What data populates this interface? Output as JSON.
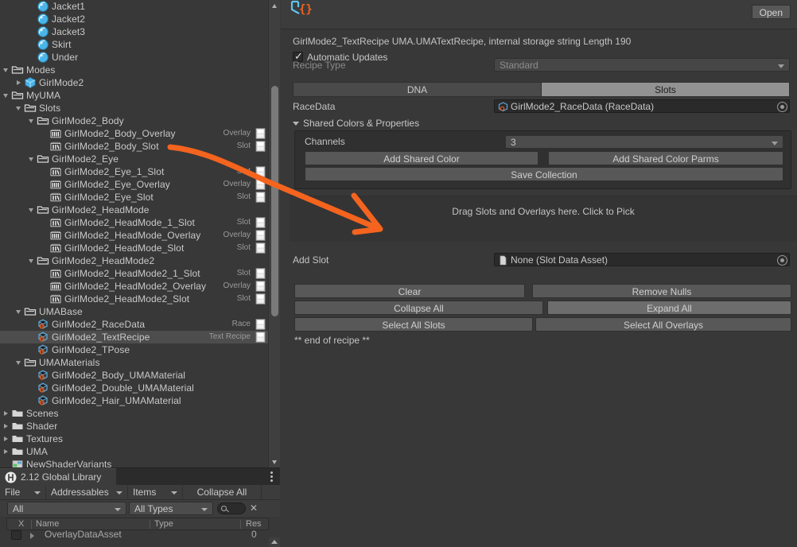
{
  "project_panel": {
    "rows": [
      {
        "indent": 3,
        "tw": "none",
        "icon": "sphere-icon",
        "label": "Jacket1",
        "type": "",
        "badge": false
      },
      {
        "indent": 3,
        "tw": "none",
        "icon": "sphere-icon",
        "label": "Jacket2",
        "type": "",
        "badge": false
      },
      {
        "indent": 3,
        "tw": "none",
        "icon": "sphere-icon",
        "label": "Jacket3",
        "type": "",
        "badge": false
      },
      {
        "indent": 3,
        "tw": "none",
        "icon": "sphere-icon",
        "label": "Skirt",
        "type": "",
        "badge": false
      },
      {
        "indent": 3,
        "tw": "none",
        "icon": "sphere-icon",
        "label": "Under",
        "type": "",
        "badge": false
      },
      {
        "indent": 1,
        "tw": "open",
        "icon": "folder-icon",
        "label": "Modes",
        "type": "",
        "badge": false
      },
      {
        "indent": 2,
        "tw": "closed",
        "icon": "prefab-icon",
        "label": "GirlMode2",
        "type": "",
        "badge": false
      },
      {
        "indent": 1,
        "tw": "open",
        "icon": "folder-icon",
        "label": "MyUMA",
        "type": "",
        "badge": false
      },
      {
        "indent": 2,
        "tw": "open",
        "icon": "folder-icon",
        "label": "Slots",
        "type": "",
        "badge": false
      },
      {
        "indent": 3,
        "tw": "open",
        "icon": "folder-icon",
        "label": "GirlMode2_Body",
        "type": "",
        "badge": false
      },
      {
        "indent": 4,
        "tw": "none",
        "icon": "overlay-icon",
        "label": "GirlMode2_Body_Overlay",
        "type": "Overlay",
        "badge": true
      },
      {
        "indent": 4,
        "tw": "none",
        "icon": "slot-icon",
        "label": "GirlMode2_Body_Slot",
        "type": "Slot",
        "badge": true
      },
      {
        "indent": 3,
        "tw": "open",
        "icon": "folder-icon",
        "label": "GirlMode2_Eye",
        "type": "",
        "badge": false
      },
      {
        "indent": 4,
        "tw": "none",
        "icon": "slot-icon",
        "label": "GirlMode2_Eye_1_Slot",
        "type": "Slot",
        "badge": true
      },
      {
        "indent": 4,
        "tw": "none",
        "icon": "overlay-icon",
        "label": "GirlMode2_Eye_Overlay",
        "type": "Overlay",
        "badge": true
      },
      {
        "indent": 4,
        "tw": "none",
        "icon": "slot-icon",
        "label": "GirlMode2_Eye_Slot",
        "type": "Slot",
        "badge": true
      },
      {
        "indent": 3,
        "tw": "open",
        "icon": "folder-icon",
        "label": "GirlMode2_HeadMode",
        "type": "",
        "badge": false
      },
      {
        "indent": 4,
        "tw": "none",
        "icon": "slot-icon",
        "label": "GirlMode2_HeadMode_1_Slot",
        "type": "Slot",
        "badge": true
      },
      {
        "indent": 4,
        "tw": "none",
        "icon": "overlay-icon",
        "label": "GirlMode2_HeadMode_Overlay",
        "type": "Overlay",
        "badge": true
      },
      {
        "indent": 4,
        "tw": "none",
        "icon": "slot-icon",
        "label": "GirlMode2_HeadMode_Slot",
        "type": "Slot",
        "badge": true
      },
      {
        "indent": 3,
        "tw": "open",
        "icon": "folder-icon",
        "label": "GirlMode2_HeadMode2",
        "type": "",
        "badge": false
      },
      {
        "indent": 4,
        "tw": "none",
        "icon": "slot-icon",
        "label": "GirlMode2_HeadMode2_1_Slot",
        "type": "Slot",
        "badge": true
      },
      {
        "indent": 4,
        "tw": "none",
        "icon": "overlay-icon",
        "label": "GirlMode2_HeadMode2_Overlay",
        "type": "Overlay",
        "badge": true
      },
      {
        "indent": 4,
        "tw": "none",
        "icon": "slot-icon",
        "label": "GirlMode2_HeadMode2_Slot",
        "type": "Slot",
        "badge": true
      },
      {
        "indent": 2,
        "tw": "open",
        "icon": "folder-icon",
        "label": "UMABase",
        "type": "",
        "badge": false
      },
      {
        "indent": 3,
        "tw": "none",
        "icon": "uma-icon",
        "label": "GirlMode2_RaceData",
        "type": "Race",
        "badge": true
      },
      {
        "indent": 3,
        "tw": "none",
        "icon": "uma-icon",
        "label": "GirlMode2_TextRecipe",
        "type": "Text Recipe",
        "badge": true,
        "selected": true
      },
      {
        "indent": 3,
        "tw": "none",
        "icon": "uma-icon",
        "label": "GirlMode2_TPose",
        "type": "",
        "badge": false
      },
      {
        "indent": 2,
        "tw": "open",
        "icon": "folder-icon",
        "label": "UMAMaterials",
        "type": "",
        "badge": false
      },
      {
        "indent": 3,
        "tw": "none",
        "icon": "uma-icon",
        "label": "GirlMode2_Body_UMAMaterial",
        "type": "",
        "badge": false
      },
      {
        "indent": 3,
        "tw": "none",
        "icon": "uma-icon",
        "label": "GirlMode2_Double_UMAMaterial",
        "type": "",
        "badge": false
      },
      {
        "indent": 3,
        "tw": "none",
        "icon": "uma-icon",
        "label": "GirlMode2_Hair_UMAMaterial",
        "type": "",
        "badge": false
      },
      {
        "indent": 1,
        "tw": "closed",
        "icon": "folder-solid-icon",
        "label": "Scenes",
        "type": "",
        "badge": false
      },
      {
        "indent": 1,
        "tw": "closed",
        "icon": "folder-solid-icon",
        "label": "Shader",
        "type": "",
        "badge": false
      },
      {
        "indent": 1,
        "tw": "closed",
        "icon": "folder-solid-icon",
        "label": "Textures",
        "type": "",
        "badge": false
      },
      {
        "indent": 1,
        "tw": "closed",
        "icon": "folder-solid-icon",
        "label": "UMA",
        "type": "",
        "badge": false
      },
      {
        "indent": 1,
        "tw": "none",
        "icon": "shadervariant-icon",
        "label": "NewShaderVariants",
        "type": "",
        "badge": false
      }
    ]
  },
  "inspector": {
    "open_button": "Open",
    "summary": "GirlMode2_TextRecipe UMA.UMATextRecipe, internal storage string Length 190",
    "automatic_updates_label": "Automatic Updates",
    "recipe_type_label": "Recipe Type",
    "recipe_type_value": "Standard",
    "tab_dna": "DNA",
    "tab_slots": "Slots",
    "racedata_label": "RaceData",
    "racedata_value": "GirlMode2_RaceData (RaceData)",
    "shared_colors_foldout": "Shared Colors & Properties",
    "channels_label": "Channels",
    "channels_value": "3",
    "add_shared_color": "Add Shared Color",
    "add_shared_color_parms": "Add Shared Color Parms",
    "save_collection": "Save Collection",
    "drop_area_text": "Drag Slots and Overlays here. Click to Pick",
    "add_slot_label": "Add Slot",
    "add_slot_value": "None (Slot Data Asset)",
    "btn_clear": "Clear",
    "btn_remove_nulls": "Remove Nulls",
    "btn_collapse_all": "Collapse All",
    "btn_expand_all": "Expand All",
    "btn_select_all_slots": "Select All Slots",
    "btn_select_all_overlays": "Select All Overlays",
    "end_of_recipe": "** end of recipe **"
  },
  "addressables": {
    "tab_title": "2.12 Global Library",
    "toolbar": {
      "file": "File",
      "addressables": "Addressables",
      "items": "Items",
      "collapse_all": "Collapse All"
    },
    "filters": {
      "group_filter": "All",
      "type_filter": "All Types",
      "search_value": ""
    },
    "columns": [
      "X",
      "Name",
      "Type",
      "Res"
    ],
    "rows": [
      {
        "name": "OverlayDataAsset",
        "res": "0"
      }
    ]
  },
  "annotation": {
    "arrow_color": "#f4641e"
  },
  "colors": {
    "panel_bg": "#383838",
    "selection": "#4d4d4d",
    "accent_orange": "#f4641e",
    "tab_active": "#929292"
  }
}
